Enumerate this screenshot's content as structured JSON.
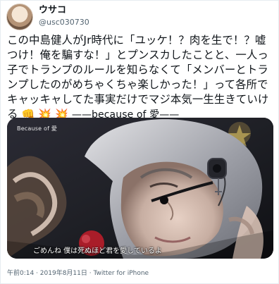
{
  "tweet": {
    "display_name": "ウサコ",
    "handle": "@usc030730",
    "text_main": "この中島健人がJr時代に「ユッケ！？肉を生で！？嘘つけ！俺を騙すな！」とプンスカしたことと、一人っ子でトランプのルールを知らなくて「メンバーとトランプしたのがめちゃくちゃ楽しかった！」って各所でキャッキャしてた事実だけでマジ本気一生生きていける",
    "emoji_1": "👊",
    "emoji_2": "💥",
    "emoji_3": "💥",
    "text_tail": "——because of 愛——",
    "timestamp": "午前0:14 · 2019年8月11日 · Twitter for iPhone"
  },
  "media": {
    "overlay_left": "Because of 愛",
    "subtitle": "ごめんね 僕は死ぬほど君を愛しているよ"
  },
  "colors": {
    "accent": "#1d9bf0",
    "meta_gray": "#536471"
  },
  "icons": {
    "avatar": "avatar-illustration",
    "media": "concert-photo"
  }
}
